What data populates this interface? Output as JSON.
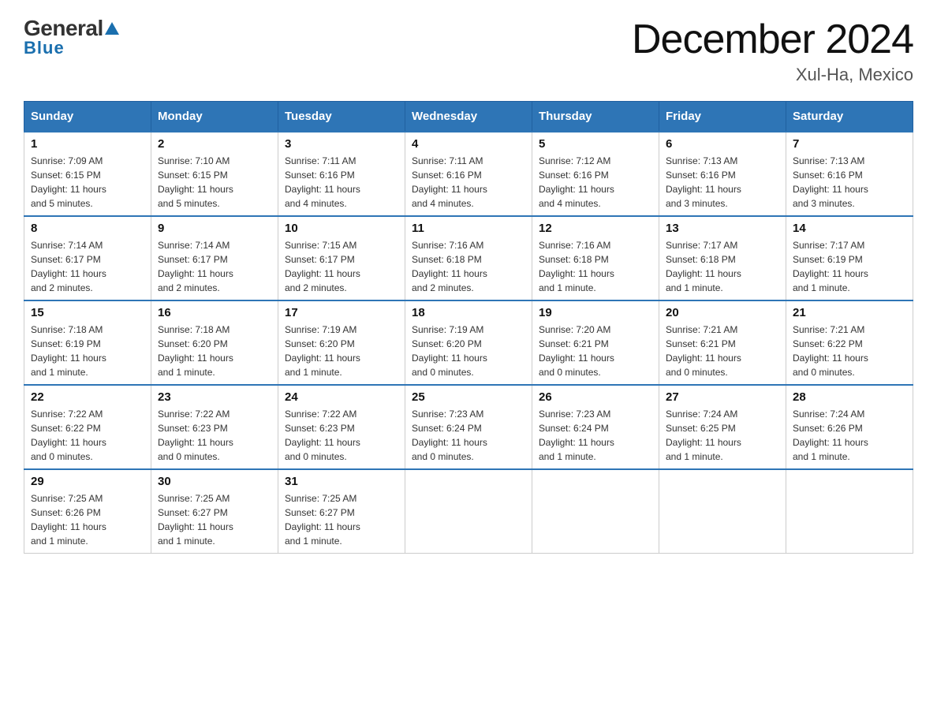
{
  "header": {
    "logo_general": "General",
    "logo_blue": "Blue",
    "main_title": "December 2024",
    "subtitle": "Xul-Ha, Mexico"
  },
  "calendar": {
    "days_of_week": [
      "Sunday",
      "Monday",
      "Tuesday",
      "Wednesday",
      "Thursday",
      "Friday",
      "Saturday"
    ],
    "weeks": [
      [
        {
          "day": "1",
          "info": "Sunrise: 7:09 AM\nSunset: 6:15 PM\nDaylight: 11 hours\nand 5 minutes."
        },
        {
          "day": "2",
          "info": "Sunrise: 7:10 AM\nSunset: 6:15 PM\nDaylight: 11 hours\nand 5 minutes."
        },
        {
          "day": "3",
          "info": "Sunrise: 7:11 AM\nSunset: 6:16 PM\nDaylight: 11 hours\nand 4 minutes."
        },
        {
          "day": "4",
          "info": "Sunrise: 7:11 AM\nSunset: 6:16 PM\nDaylight: 11 hours\nand 4 minutes."
        },
        {
          "day": "5",
          "info": "Sunrise: 7:12 AM\nSunset: 6:16 PM\nDaylight: 11 hours\nand 4 minutes."
        },
        {
          "day": "6",
          "info": "Sunrise: 7:13 AM\nSunset: 6:16 PM\nDaylight: 11 hours\nand 3 minutes."
        },
        {
          "day": "7",
          "info": "Sunrise: 7:13 AM\nSunset: 6:16 PM\nDaylight: 11 hours\nand 3 minutes."
        }
      ],
      [
        {
          "day": "8",
          "info": "Sunrise: 7:14 AM\nSunset: 6:17 PM\nDaylight: 11 hours\nand 2 minutes."
        },
        {
          "day": "9",
          "info": "Sunrise: 7:14 AM\nSunset: 6:17 PM\nDaylight: 11 hours\nand 2 minutes."
        },
        {
          "day": "10",
          "info": "Sunrise: 7:15 AM\nSunset: 6:17 PM\nDaylight: 11 hours\nand 2 minutes."
        },
        {
          "day": "11",
          "info": "Sunrise: 7:16 AM\nSunset: 6:18 PM\nDaylight: 11 hours\nand 2 minutes."
        },
        {
          "day": "12",
          "info": "Sunrise: 7:16 AM\nSunset: 6:18 PM\nDaylight: 11 hours\nand 1 minute."
        },
        {
          "day": "13",
          "info": "Sunrise: 7:17 AM\nSunset: 6:18 PM\nDaylight: 11 hours\nand 1 minute."
        },
        {
          "day": "14",
          "info": "Sunrise: 7:17 AM\nSunset: 6:19 PM\nDaylight: 11 hours\nand 1 minute."
        }
      ],
      [
        {
          "day": "15",
          "info": "Sunrise: 7:18 AM\nSunset: 6:19 PM\nDaylight: 11 hours\nand 1 minute."
        },
        {
          "day": "16",
          "info": "Sunrise: 7:18 AM\nSunset: 6:20 PM\nDaylight: 11 hours\nand 1 minute."
        },
        {
          "day": "17",
          "info": "Sunrise: 7:19 AM\nSunset: 6:20 PM\nDaylight: 11 hours\nand 1 minute."
        },
        {
          "day": "18",
          "info": "Sunrise: 7:19 AM\nSunset: 6:20 PM\nDaylight: 11 hours\nand 0 minutes."
        },
        {
          "day": "19",
          "info": "Sunrise: 7:20 AM\nSunset: 6:21 PM\nDaylight: 11 hours\nand 0 minutes."
        },
        {
          "day": "20",
          "info": "Sunrise: 7:21 AM\nSunset: 6:21 PM\nDaylight: 11 hours\nand 0 minutes."
        },
        {
          "day": "21",
          "info": "Sunrise: 7:21 AM\nSunset: 6:22 PM\nDaylight: 11 hours\nand 0 minutes."
        }
      ],
      [
        {
          "day": "22",
          "info": "Sunrise: 7:22 AM\nSunset: 6:22 PM\nDaylight: 11 hours\nand 0 minutes."
        },
        {
          "day": "23",
          "info": "Sunrise: 7:22 AM\nSunset: 6:23 PM\nDaylight: 11 hours\nand 0 minutes."
        },
        {
          "day": "24",
          "info": "Sunrise: 7:22 AM\nSunset: 6:23 PM\nDaylight: 11 hours\nand 0 minutes."
        },
        {
          "day": "25",
          "info": "Sunrise: 7:23 AM\nSunset: 6:24 PM\nDaylight: 11 hours\nand 0 minutes."
        },
        {
          "day": "26",
          "info": "Sunrise: 7:23 AM\nSunset: 6:24 PM\nDaylight: 11 hours\nand 1 minute."
        },
        {
          "day": "27",
          "info": "Sunrise: 7:24 AM\nSunset: 6:25 PM\nDaylight: 11 hours\nand 1 minute."
        },
        {
          "day": "28",
          "info": "Sunrise: 7:24 AM\nSunset: 6:26 PM\nDaylight: 11 hours\nand 1 minute."
        }
      ],
      [
        {
          "day": "29",
          "info": "Sunrise: 7:25 AM\nSunset: 6:26 PM\nDaylight: 11 hours\nand 1 minute."
        },
        {
          "day": "30",
          "info": "Sunrise: 7:25 AM\nSunset: 6:27 PM\nDaylight: 11 hours\nand 1 minute."
        },
        {
          "day": "31",
          "info": "Sunrise: 7:25 AM\nSunset: 6:27 PM\nDaylight: 11 hours\nand 1 minute."
        },
        {
          "day": "",
          "info": ""
        },
        {
          "day": "",
          "info": ""
        },
        {
          "day": "",
          "info": ""
        },
        {
          "day": "",
          "info": ""
        }
      ]
    ]
  }
}
